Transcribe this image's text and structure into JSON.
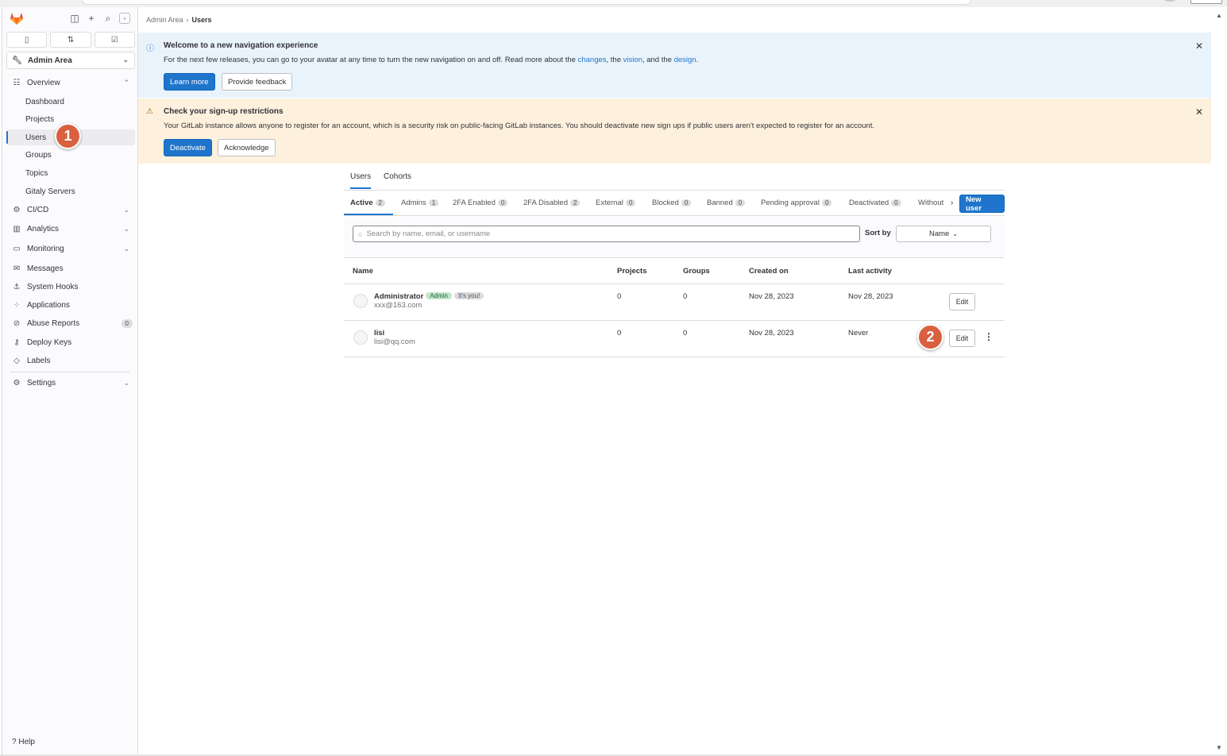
{
  "sidebar": {
    "context_title": "Admin Area",
    "overview_label": "Overview",
    "overview_items": [
      "Dashboard",
      "Projects",
      "Users",
      "Groups",
      "Topics",
      "Gitaly Servers"
    ],
    "cicd_label": "CI/CD",
    "analytics_label": "Analytics",
    "monitoring_label": "Monitoring",
    "messages_label": "Messages",
    "system_hooks_label": "System Hooks",
    "applications_label": "Applications",
    "abuse_reports_label": "Abuse Reports",
    "abuse_reports_count": "0",
    "deploy_keys_label": "Deploy Keys",
    "labels_label": "Labels",
    "settings_label": "Settings",
    "help_label": "Help"
  },
  "breadcrumb": {
    "parent": "Admin Area",
    "separator": "›",
    "current": "Users"
  },
  "nav_alert": {
    "title": "Welcome to a new navigation experience",
    "body_prefix": "For the next few releases, you can go to your avatar at any time to turn the new navigation on and off. Read more about the ",
    "link_changes": "changes",
    "body_mid1": ", the ",
    "link_vision": "vision",
    "body_mid2": ", and the ",
    "link_design": "design",
    "body_suffix": ".",
    "learn_more": "Learn more",
    "feedback": "Provide feedback"
  },
  "signup_alert": {
    "title": "Check your sign-up restrictions",
    "body": "Your GitLab instance allows anyone to register for an account, which is a security risk on public-facing GitLab instances. You should deactivate new sign ups if public users aren't expected to register for an account.",
    "deactivate": "Deactivate",
    "acknowledge": "Acknowledge"
  },
  "top_tabs": [
    "Users",
    "Cohorts"
  ],
  "filter_tabs": [
    {
      "label": "Active",
      "count": "2"
    },
    {
      "label": "Admins",
      "count": "1"
    },
    {
      "label": "2FA Enabled",
      "count": "0"
    },
    {
      "label": "2FA Disabled",
      "count": "2"
    },
    {
      "label": "External",
      "count": "0"
    },
    {
      "label": "Blocked",
      "count": "0"
    },
    {
      "label": "Banned",
      "count": "0"
    },
    {
      "label": "Pending approval",
      "count": "0"
    },
    {
      "label": "Deactivated",
      "count": "0"
    },
    {
      "label": "Without",
      "count": ""
    }
  ],
  "new_user_button": "New user",
  "search": {
    "placeholder": "Search by name, email, or username"
  },
  "sort": {
    "label": "Sort by",
    "value": "Name"
  },
  "table": {
    "headers": [
      "Name",
      "Projects",
      "Groups",
      "Created on",
      "Last activity"
    ],
    "rows": [
      {
        "name": "Administrator",
        "badge_admin": "Admin",
        "badge_you": "It's you!",
        "email": "xxx@163.com",
        "projects": "0",
        "groups": "0",
        "created": "Nov 28, 2023",
        "last_activity": "Nov 28, 2023",
        "edit": "Edit"
      },
      {
        "name": "lisi",
        "email": "lisi@qq.com",
        "projects": "0",
        "groups": "0",
        "created": "Nov 28, 2023",
        "last_activity": "Never",
        "edit": "Edit"
      }
    ]
  },
  "markers": [
    "1",
    "2"
  ],
  "colors": {
    "primary": "#1f75cb",
    "marker": "#d9603f",
    "info_bg": "#e9f3fc",
    "warn_bg": "#fdf1dd"
  }
}
